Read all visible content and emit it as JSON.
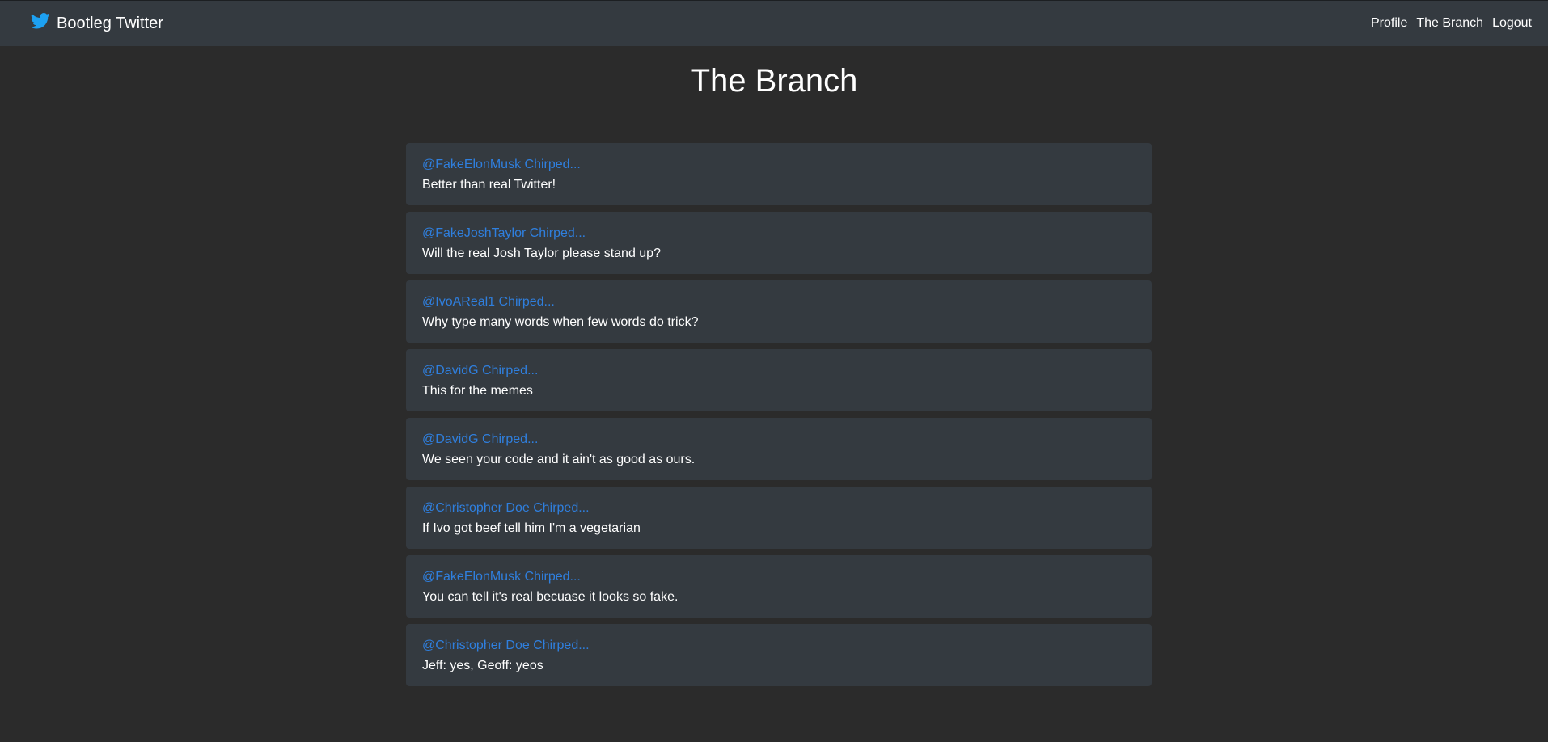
{
  "navbar": {
    "brand": "Bootleg Twitter",
    "brand_icon": "twitter-bird-icon",
    "links": [
      {
        "label": "Profile"
      },
      {
        "label": "The Branch"
      },
      {
        "label": "Logout"
      }
    ]
  },
  "page": {
    "title": "The Branch"
  },
  "chirps": [
    {
      "author": "@FakeElonMusk Chirped...",
      "text": "Better than real Twitter!"
    },
    {
      "author": "@FakeJoshTaylor Chirped...",
      "text": "Will the real Josh Taylor please stand up?"
    },
    {
      "author": "@IvoAReal1 Chirped...",
      "text": "Why type many words when few words do trick?"
    },
    {
      "author": "@DavidG Chirped...",
      "text": "This for the memes"
    },
    {
      "author": "@DavidG Chirped...",
      "text": "We seen your code and it ain't as good as ours."
    },
    {
      "author": "@Christopher Doe Chirped...",
      "text": "If Ivo got beef tell him I'm a vegetarian"
    },
    {
      "author": "@FakeElonMusk Chirped...",
      "text": "You can tell it's real becuase it looks so fake."
    },
    {
      "author": "@Christopher Doe Chirped...",
      "text": "Jeff: yes, Geoff: yeos"
    }
  ],
  "colors": {
    "background": "#2b2b2b",
    "navbar": "#343a40",
    "card": "#343a40",
    "author_link": "#2f7fde",
    "brand_icon": "#1da1f2"
  }
}
